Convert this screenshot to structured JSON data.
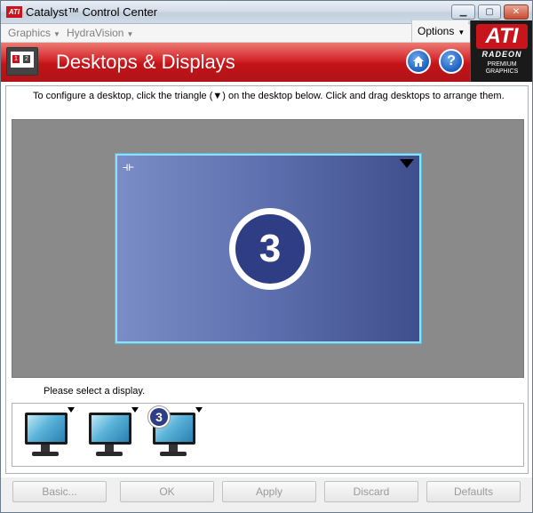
{
  "window": {
    "title": "Catalyst™ Control Center",
    "logo_text": "ATI"
  },
  "menubar": {
    "graphics": "Graphics",
    "hydravision": "HydraVision",
    "options": "Options"
  },
  "header": {
    "title": "Desktops & Displays",
    "home_icon": "home-icon",
    "help_label": "?"
  },
  "brand": {
    "ati": "ATI",
    "radeon": "RADEON",
    "premium_line1": "PREMIUM",
    "premium_line2": "GRAPHICS",
    "color": "#c8141c"
  },
  "main": {
    "instruction": "To configure a desktop, click the triangle (▼) on the desktop below.  Click and drag desktops to arrange them.",
    "desktop_number": "3",
    "select_label": "Please select a display.",
    "displays": [
      {
        "badge": ""
      },
      {
        "badge": ""
      },
      {
        "badge": "3"
      }
    ]
  },
  "buttons": {
    "basic": "Basic...",
    "ok": "OK",
    "apply": "Apply",
    "discard": "Discard",
    "defaults": "Defaults"
  }
}
